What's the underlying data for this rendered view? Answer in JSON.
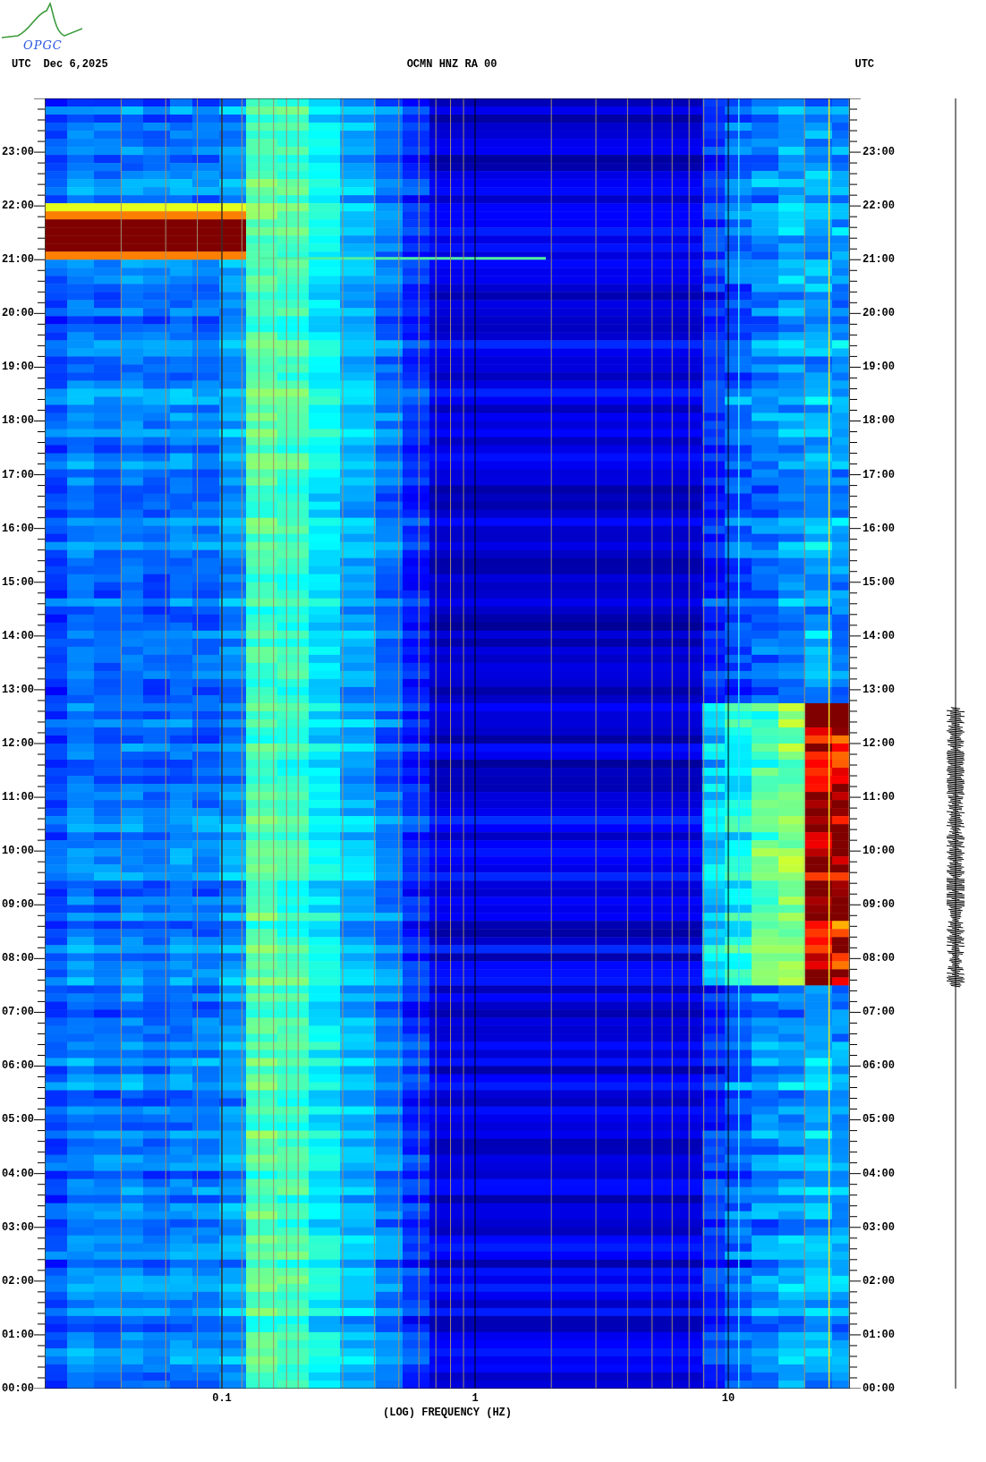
{
  "logo": {
    "text": "OPGC"
  },
  "header": {
    "left_timezone": "UTC",
    "date": "Dec 6,2025",
    "station": "OCMN HNZ RA 00",
    "right_timezone": "UTC"
  },
  "spectrogram": {
    "y_labels_left": [
      "23:00",
      "22:00",
      "21:00",
      "20:00",
      "19:00",
      "18:00",
      "17:00",
      "16:00",
      "15:00",
      "14:00",
      "13:00",
      "12:00",
      "11:00",
      "10:00",
      "09:00",
      "08:00",
      "07:00",
      "06:00",
      "05:00",
      "04:00",
      "03:00",
      "02:00",
      "01:00",
      "00:00"
    ],
    "y_labels_right": [
      "23:00",
      "22:00",
      "21:00",
      "20:00",
      "19:00",
      "18:00",
      "17:00",
      "16:00",
      "15:00",
      "14:00",
      "13:00",
      "12:00",
      "11:00",
      "10:00",
      "09:00",
      "08:00",
      "07:00",
      "06:00",
      "05:00",
      "04:00",
      "03:00",
      "02:00",
      "01:00",
      "00:00"
    ],
    "x_ticks": [
      "0.1",
      "1",
      "10"
    ],
    "xlabel": "(LOG) FREQUENCY (HZ)"
  }
}
